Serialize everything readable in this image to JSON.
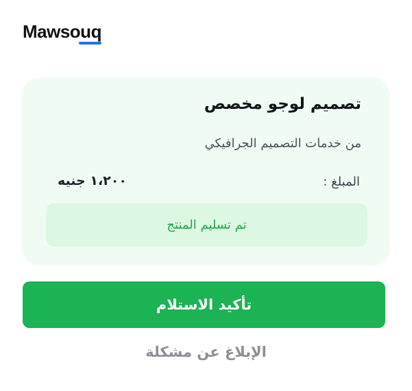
{
  "brand": {
    "logo_text": "Mawsouq",
    "accent_color": "#1a73e8"
  },
  "order_card": {
    "title": "تصميم لوجو مخصص",
    "subtitle": "من خدمات التصميم الجرافيكي",
    "amount_label": "المبلغ :",
    "amount_value": "١،٢٠٠ جنيه",
    "status_text": "تم تسليم المنتج",
    "background_color": "#f0fcf3",
    "status_color": "#1fa74a"
  },
  "actions": {
    "confirm_label": "تأكيد الاستلام",
    "confirm_color": "#1bb354",
    "report_label": "الإبلاغ عن مشكلة"
  }
}
